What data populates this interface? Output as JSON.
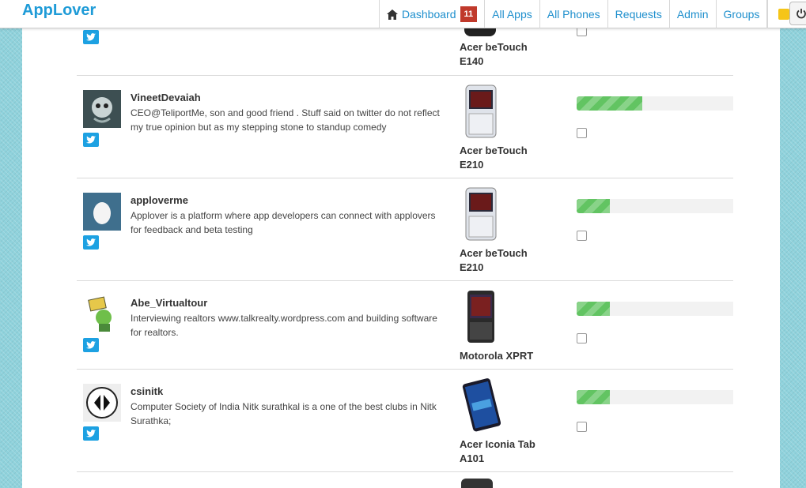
{
  "nav": {
    "brand": "AppLover",
    "dashboard": "Dashboard",
    "dashboard_badge": "11",
    "all_apps": "All Apps",
    "all_phones": "All Phones",
    "requests": "Requests",
    "admin": "Admin",
    "groups": "Groups"
  },
  "top_partial": {
    "phone_line1": "Acer beTouch",
    "phone_line2": "E140"
  },
  "testers": [
    {
      "username": "VineetDevaiah",
      "bio": "CEO@TeliportMe, son and good friend . Stuff said on twitter do not reflect my true opinion but as my stepping stone to standup comedy",
      "phone_line1": "Acer beTouch",
      "phone_line2": "E210",
      "progress": 0.42
    },
    {
      "username": "apploverme",
      "bio": "Applover is a platform where app developers can connect with applovers for feedback and beta testing",
      "phone_line1": "Acer beTouch",
      "phone_line2": "E210",
      "progress": 0.21
    },
    {
      "username": "Abe_Virtualtour",
      "bio": "Interviewing realtors www.talkrealty.wordpress.com and building software for realtors.",
      "phone_line1": "Motorola XPRT",
      "phone_line2": "",
      "progress": 0.21
    },
    {
      "username": "csinitk",
      "bio": "Computer Society of India Nitk surathkal is a one of the best clubs in Nitk Surathka;",
      "phone_line1": "Acer Iconia Tab",
      "phone_line2": "A101",
      "progress": 0.21
    }
  ],
  "colors": {
    "brand": "#1e9bd7",
    "link": "#1e8fcd",
    "badge": "#c0392b",
    "progress": "#62c462",
    "twitter": "#1da1e2",
    "background": "#8fd2dc"
  }
}
